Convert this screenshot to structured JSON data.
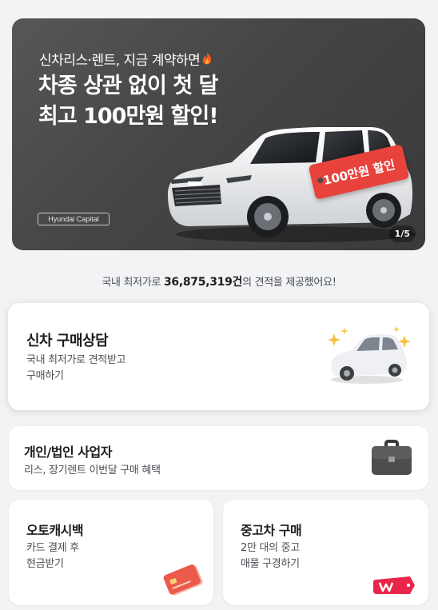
{
  "banner": {
    "subtitle": "신차리스·렌트, 지금 계약하면",
    "headline_line1": "차종 상관 없이 첫 달",
    "headline_line2": "최고 100만원 할인!",
    "price_tag": "100만원 할인",
    "brand": "Hyundai Capital",
    "pager": "1/5",
    "icons": [
      "fire-icon",
      "white-suv-image"
    ]
  },
  "stats": {
    "prefix": "국내 최저가로 ",
    "count": "36,875,319건",
    "suffix": "의 견적을 제공했어요!"
  },
  "cards": {
    "new_car": {
      "title": "신차 구매상담",
      "desc_line1": "국내 최저가로 견적받고",
      "desc_line2": "구매하기",
      "icon": "sparkle-car-icon"
    },
    "business": {
      "title": "개인/법인 사업자",
      "desc": "리스, 장기렌트 이번달 구매 혜택",
      "icon": "briefcase-icon"
    },
    "cashback": {
      "title": "오토캐시백",
      "desc_line1": "카드 결제 후",
      "desc_line2": "현금받기",
      "icon": "credit-card-icon"
    },
    "used_car": {
      "title": "중고차 구매",
      "desc_line1": "2만 대의 중고",
      "desc_line2": "매물 구경하기",
      "icon": "red-tag-icon"
    }
  },
  "colors": {
    "accent_red": "#e8423d",
    "banner_bg": "#4a4a4a",
    "page_bg": "#f2f3f5"
  }
}
